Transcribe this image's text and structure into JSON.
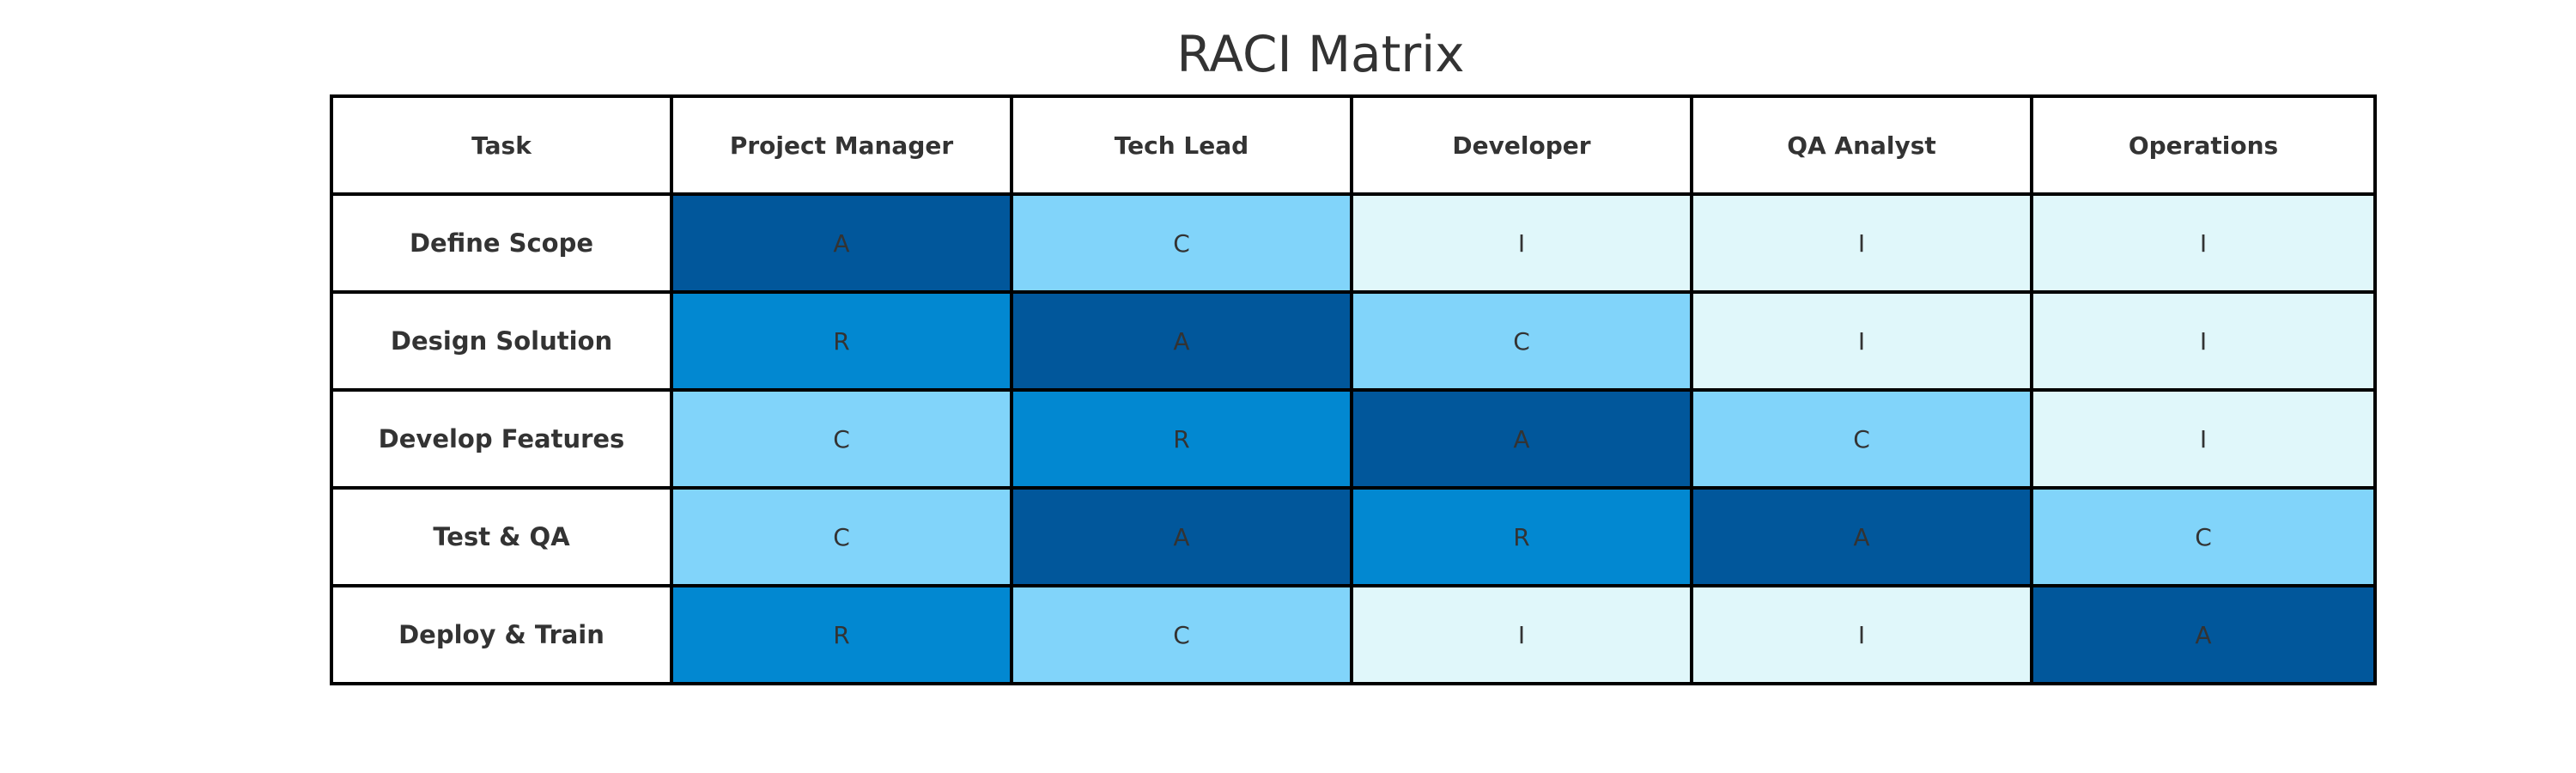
{
  "chart_data": {
    "type": "table",
    "title": "RACI Matrix",
    "columns": [
      "Task",
      "Project Manager",
      "Tech Lead",
      "Developer",
      "QA Analyst",
      "Operations"
    ],
    "rows": [
      {
        "task": "Define Scope",
        "values": [
          "A",
          "C",
          "I",
          "I",
          "I"
        ]
      },
      {
        "task": "Design Solution",
        "values": [
          "R",
          "A",
          "C",
          "I",
          "I"
        ]
      },
      {
        "task": "Develop Features",
        "values": [
          "C",
          "R",
          "A",
          "C",
          "I"
        ]
      },
      {
        "task": "Test & QA",
        "values": [
          "C",
          "A",
          "R",
          "A",
          "C"
        ]
      },
      {
        "task": "Deploy & Train",
        "values": [
          "R",
          "C",
          "I",
          "I",
          "A"
        ]
      }
    ],
    "colors": {
      "R": "#0288d1",
      "A": "#01579b",
      "C": "#81d4fa",
      "I": "#e0f7fa",
      "border": "#000000",
      "text": "#333333",
      "header_bg": "#ffffff"
    }
  }
}
